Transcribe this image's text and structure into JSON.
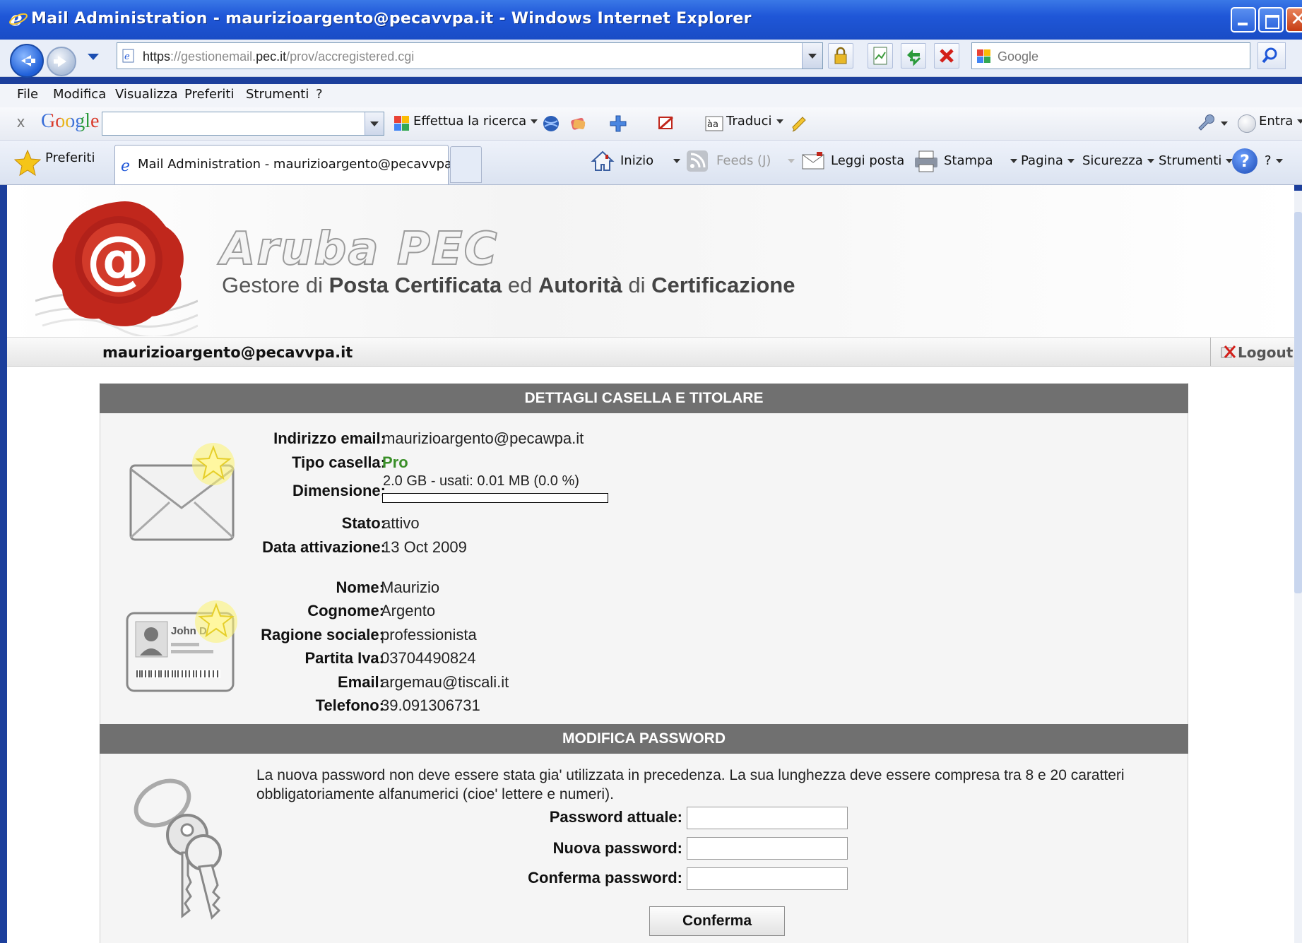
{
  "window": {
    "title": "Mail Administration - maurizioargento@pecavvpa.it - Windows Internet Explorer"
  },
  "address_bar": {
    "url_scheme": "https",
    "url_sep": "://",
    "url_host_prefix": "gestionemail.",
    "url_host_main": "pec.it",
    "url_path": "/prov/accregistered.cgi",
    "search_placeholder": "Google"
  },
  "menu": [
    "File",
    "Modifica",
    "Visualizza",
    "Preferiti",
    "Strumenti",
    "?"
  ],
  "google_toolbar": {
    "close": "x",
    "logo": "Google",
    "search_label": "Effettua la ricerca",
    "translate_label": "Traduci",
    "signin_label": "Entra"
  },
  "favorites_bar": {
    "favorites_label": "Preferiti",
    "tab_title": "Mail Administration - maurizioargento@pecavvpa.it",
    "home_label": "Inizio",
    "feeds_label": "Feeds (J)",
    "read_mail_label": "Leggi posta",
    "print_label": "Stampa",
    "page_label": "Pagina",
    "security_label": "Sicurezza",
    "tools_label": "Strumenti",
    "help_label": "?"
  },
  "page": {
    "brand": "Aruba PEC",
    "tagline_parts": [
      "Gestore di ",
      "Posta Certificata",
      " ed ",
      "Autorità",
      " di ",
      "Certificazione"
    ],
    "user": "maurizioargento@pecavvpa.it",
    "logout_label": "Logout",
    "details_header": "DETTAGLI CASELLA E TITOLARE",
    "mailbox": {
      "email_label": "Indirizzo email:",
      "email_value": "maurizioargento@pecawpa.it",
      "type_label": "Tipo casella:",
      "type_value": "Pro",
      "size_label": "Dimensione:",
      "size_value": "2.0 GB - usati: 0.01 MB (0.0 %)",
      "usage_fraction": 0.0,
      "status_label": "Stato:",
      "status_value": "attivo",
      "activation_label": "Data attivazione:",
      "activation_value": "13 Oct 2009"
    },
    "owner": {
      "name_label": "Nome:",
      "name_value": "Maurizio",
      "surname_label": "Cognome:",
      "surname_value": "Argento",
      "company_label": "Ragione sociale:",
      "company_value": "professionista",
      "vat_label": "Partita Iva:",
      "vat_value": "03704490824",
      "email_label": "Email:",
      "email_value": "argemau@tiscali.it",
      "phone_label": "Telefono:",
      "phone_value": "39.091306731",
      "card_text": "John D"
    },
    "password_header": "MODIFICA PASSWORD",
    "password_notice": "La nuova password non deve essere stata gia' utilizzata in precedenza. La sua lunghezza deve essere compresa tra 8 e 20 caratteri obbligatoriamente alfanumerici (cioe' lettere e numeri).",
    "current_password_label": "Password attuale:",
    "new_password_label": "Nuova password:",
    "confirm_password_label": "Conferma password:",
    "confirm_button": "Conferma"
  },
  "colors": {
    "titlebar": "#1f57d8",
    "section_header": "#707070",
    "pro_green": "#3a8f28",
    "seal_red": "#c0271c"
  }
}
